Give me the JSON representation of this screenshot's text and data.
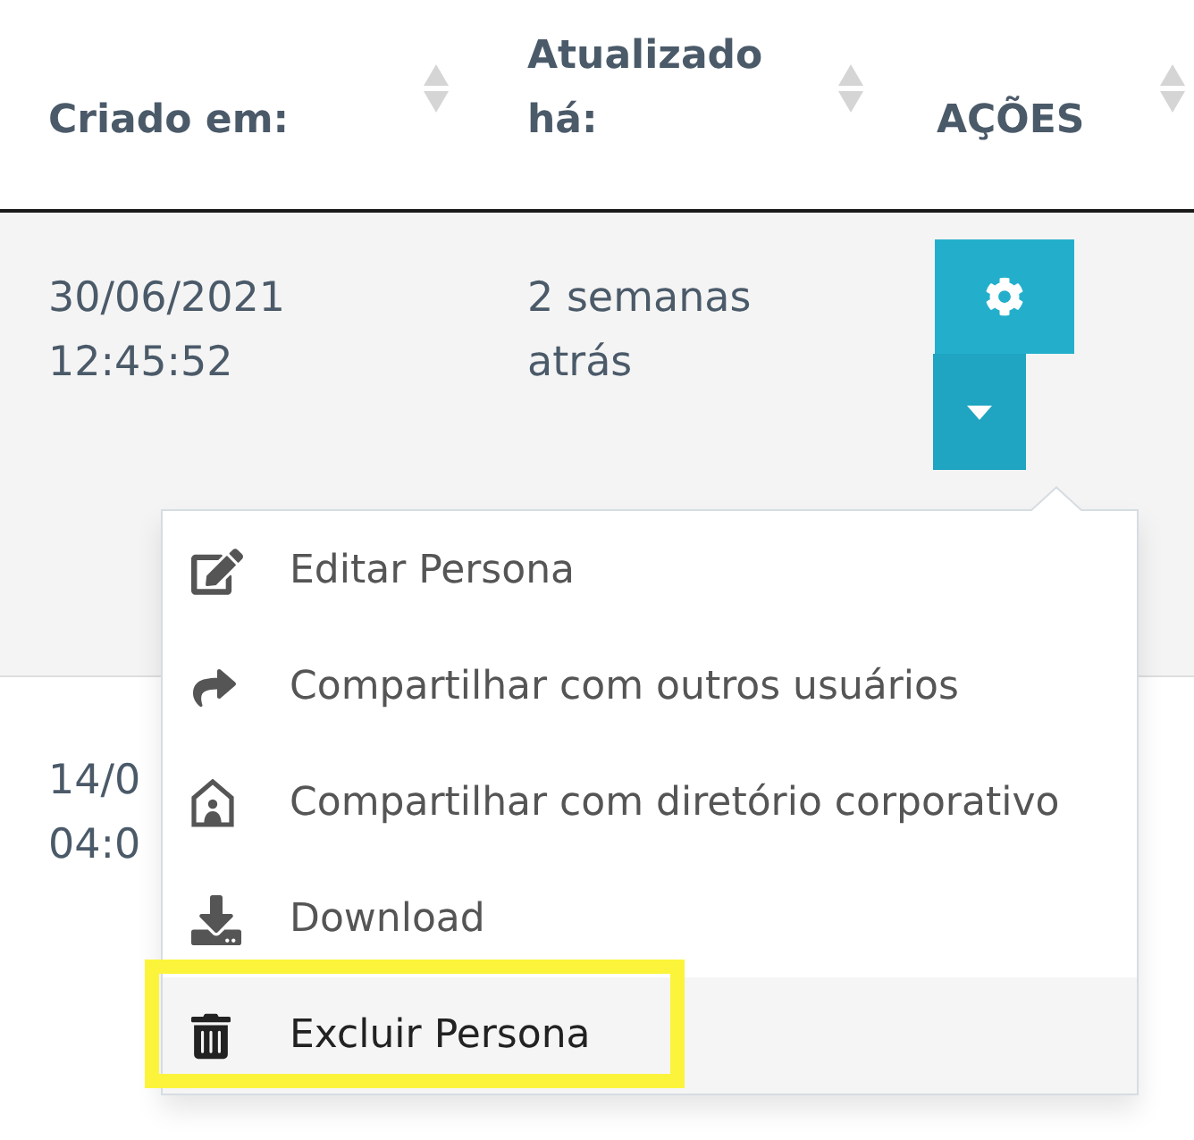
{
  "table": {
    "columns": [
      {
        "label": "Criado em:",
        "sortable": true
      },
      {
        "label": "Atualizado há:",
        "sortable": true
      },
      {
        "label": "AÇÕES",
        "sortable": true
      }
    ],
    "rows": [
      {
        "created": {
          "date": "30/06/2021",
          "time": "12:45:52"
        },
        "updated": "2 semanas atrás",
        "actions": {
          "menu_open": true,
          "menu": [
            {
              "kind": "edit",
              "label": "Editar Persona",
              "hovered": false,
              "highlighted": false
            },
            {
              "kind": "share",
              "label": "Compartilhar com outros usuários",
              "hovered": false,
              "highlighted": false
            },
            {
              "kind": "directory",
              "label": "Compartilhar com diretório corporativo",
              "hovered": false,
              "highlighted": false
            },
            {
              "kind": "download",
              "label": "Download",
              "hovered": false,
              "highlighted": false
            },
            {
              "kind": "delete",
              "label": "Excluir Persona",
              "hovered": true,
              "highlighted": true
            }
          ]
        }
      },
      {
        "created": {
          "date": "14/0",
          "time": "04:0"
        }
      }
    ]
  }
}
